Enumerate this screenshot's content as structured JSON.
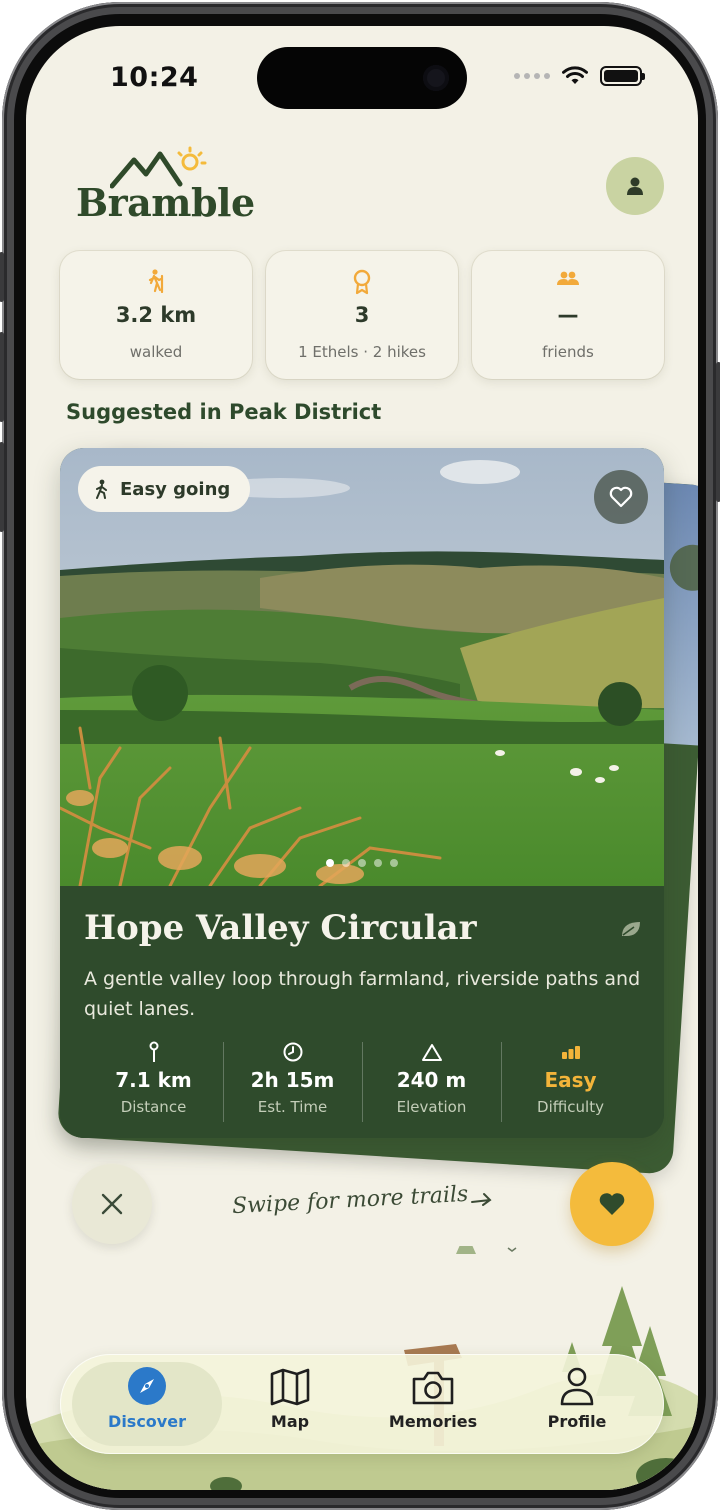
{
  "status_bar": {
    "time": "10:24"
  },
  "header": {
    "app_name": "Bramble"
  },
  "stats": [
    {
      "icon": "hiker-icon",
      "value": "3.2 km",
      "label": "walked"
    },
    {
      "icon": "award-icon",
      "value": "3",
      "label": "1 Ethels · 2 hikes"
    },
    {
      "icon": "friends-icon",
      "value": "—",
      "label": "friends"
    }
  ],
  "section": {
    "title": "Suggested in Peak District"
  },
  "trail_card": {
    "badge": "Easy going",
    "name": "Hope Valley Circular",
    "description": "A gentle valley loop through farmland, riverside paths and quiet lanes.",
    "photo_index": 1,
    "photo_count": 5,
    "metrics": [
      {
        "icon": "pin-icon",
        "value": "7.1 km",
        "label": "Distance"
      },
      {
        "icon": "clock-icon",
        "value": "2h 15m",
        "label": "Est. Time"
      },
      {
        "icon": "mountain-icon",
        "value": "240 m",
        "label": "Elevation"
      },
      {
        "icon": "bars-icon",
        "value": "Easy",
        "label": "Difficulty"
      }
    ]
  },
  "actions": {
    "hint": "Swipe for more trails"
  },
  "nav": {
    "items": [
      {
        "label": "Discover",
        "icon": "compass-icon",
        "active": true
      },
      {
        "label": "Map",
        "icon": "map-icon",
        "active": false
      },
      {
        "label": "Memories",
        "icon": "camera-icon",
        "active": false
      },
      {
        "label": "Profile",
        "icon": "person-icon",
        "active": false
      }
    ]
  },
  "colors": {
    "accent_green": "#2f4b2c",
    "accent_yellow": "#f4bb3c",
    "background": "#f3f1e6",
    "nav_active": "#2b79c9"
  }
}
